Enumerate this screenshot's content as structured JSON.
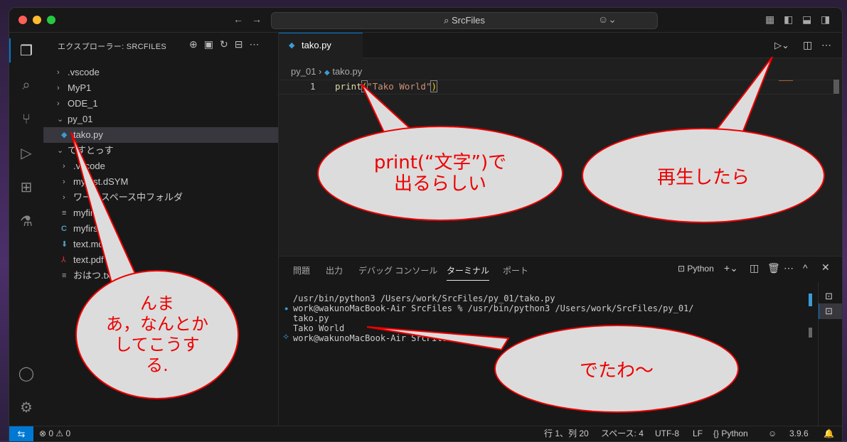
{
  "titlebar": {
    "search": "SrcFiles"
  },
  "sidebar": {
    "title": "エクスプローラー: SRCFILES",
    "items": [
      {
        "label": ".vscode"
      },
      {
        "label": "MyP1"
      },
      {
        "label": "ODE_1"
      },
      {
        "label": "py_01"
      },
      {
        "label": "tako.py"
      },
      {
        "label": "てすとっす"
      },
      {
        "label": ".vscode"
      },
      {
        "label": "mytest.dSYM"
      },
      {
        "label": "ワークスペース中フォルダ"
      },
      {
        "label": "myfirst"
      },
      {
        "label": "myfirst"
      },
      {
        "label": "text.md"
      },
      {
        "label": "text.pdf"
      },
      {
        "label": "おはつ.txt"
      }
    ]
  },
  "editor": {
    "tab_label": "tako.py",
    "breadcrumb_folder": "py_01",
    "breadcrumb_sep": "›",
    "breadcrumb_file": "tako.py",
    "line_number": "1",
    "code_func": "print",
    "code_open": "(",
    "code_string": "\"Tako World\"",
    "code_close": ")"
  },
  "panel": {
    "tabs": [
      "問題",
      "出力",
      "デバッグ コンソール",
      "ターミナル",
      "ポート"
    ],
    "active_tab": "ターミナル",
    "shell_label": "Python",
    "terminal_lines": [
      "/usr/bin/python3 /Users/work/SrcFiles/py_01/tako.py",
      "work@wakunoMacBook-Air SrcFiles % /usr/bin/python3 /Users/work/SrcFiles/py_01/",
      "tako.py",
      "Tako World",
      "work@wakunoMacBook-Air SrcFiles %"
    ]
  },
  "status": {
    "problems": "⊗ 0 ⚠ 0",
    "position": "行 1、列 20",
    "spaces": "スペース: 4",
    "encoding": "UTF-8",
    "eol": "LF",
    "language": "Python",
    "python_version": "3.9.6"
  },
  "annotations": {
    "bubble_code": "print(“文字”)で\n出るらしい",
    "bubble_run": "再生したら",
    "bubble_sidebar": "んま\nあ，なんとか\nしてこうす\nる.",
    "bubble_output": "でたわ〜"
  },
  "colors": {
    "accent": "#0078d4",
    "annotation": "#e00000",
    "string": "#ce9178",
    "func": "#dcdcaa"
  }
}
